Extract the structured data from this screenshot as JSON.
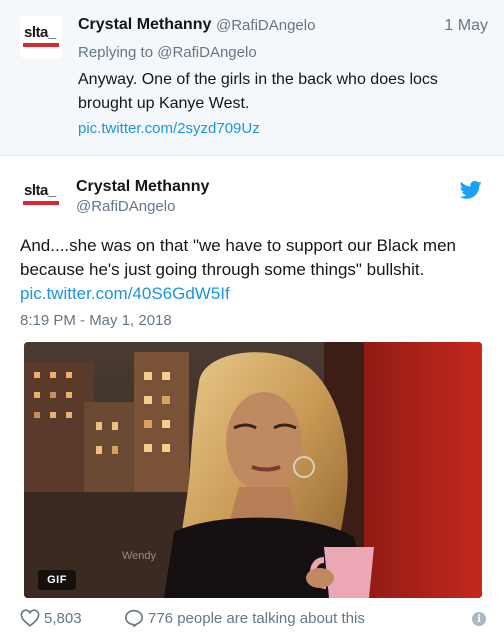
{
  "parent_tweet": {
    "avatar_text": "slta_",
    "display_name": "Crystal Methanny",
    "handle": "@RafiDAngelo",
    "date": "1 May",
    "replying_prefix": "Replying to",
    "replying_to": "@RafiDAngelo",
    "text": "Anyway. One of the girls in the back who does locs brought up Kanye West.",
    "link": "pic.twitter.com/2syzd709Uz"
  },
  "main_tweet": {
    "avatar_text": "slta_",
    "display_name": "Crystal Methanny",
    "handle": "@RafiDAngelo",
    "text": "And....she was on that \"we have to support our Black men because he's just going through some things\" bullshit.",
    "link": "pic.twitter.com/40S6GdW5If",
    "timestamp": "8:19 PM - May 1, 2018",
    "media": {
      "badge": "GIF",
      "watermark": "Wendy"
    }
  },
  "footer": {
    "likes": "5,803",
    "talking": "776 people are talking about this",
    "info_glyph": "i"
  },
  "colors": {
    "link": "#1b95e0",
    "secondary_text": "#657786",
    "twitter_bird": "#1da1f2",
    "logo_red": "#d7282f",
    "parent_background": "#f5f8fa"
  },
  "icons": [
    "twitter-bird-icon",
    "heart-icon",
    "reply-bubble-icon",
    "info-icon"
  ]
}
